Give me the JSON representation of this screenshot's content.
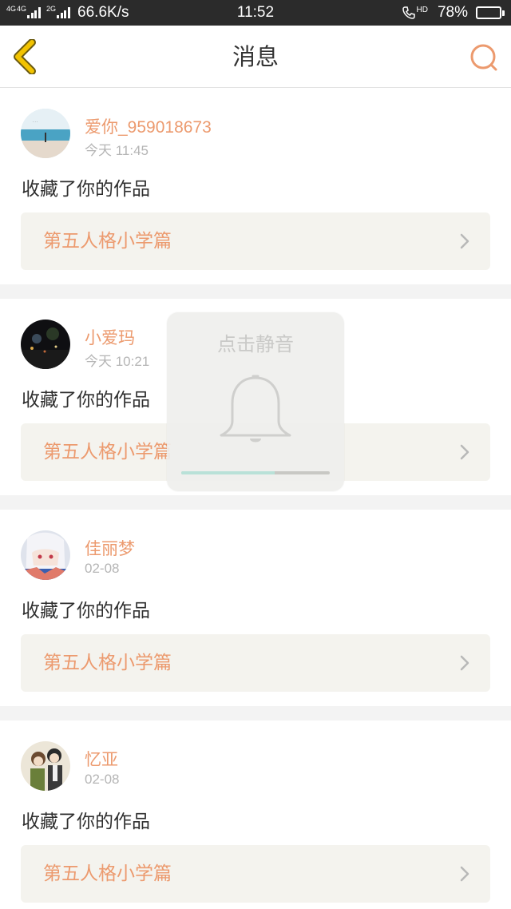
{
  "status_bar": {
    "net1": "4G",
    "net2": "4G",
    "net3": "2G",
    "speed": "66.6K/s",
    "time": "11:52",
    "hd": "HD",
    "battery": "78%",
    "battery_level": 0.78
  },
  "nav": {
    "title": "消息",
    "back_icon": "chevron-left-icon",
    "search_icon": "search-icon",
    "accent_back": "#f2c300",
    "accent_search": "#ec9a6e"
  },
  "messages": [
    {
      "user": "爱你_959018673",
      "time": "今天 11:45",
      "text": "收藏了你的作品",
      "work": "第五人格小学篇"
    },
    {
      "user": "小爱玛",
      "time": "今天 10:21",
      "text": "收藏了你的作品",
      "work": "第五人格小学篇"
    },
    {
      "user": "佳丽梦",
      "time": "02-08",
      "text": "收藏了你的作品",
      "work": "第五人格小学篇"
    },
    {
      "user": "忆亚",
      "time": "02-08",
      "text": "收藏了你的作品",
      "work": "第五人格小学篇"
    }
  ],
  "toast": {
    "label": "点击静音",
    "icon": "bell-icon",
    "volume_level": 0.63
  },
  "colors": {
    "username": "#ec9a6e",
    "work_title": "#ec9a6e",
    "work_bg": "#f4f3ee",
    "status_bar_bg": "#2b2b2b"
  }
}
